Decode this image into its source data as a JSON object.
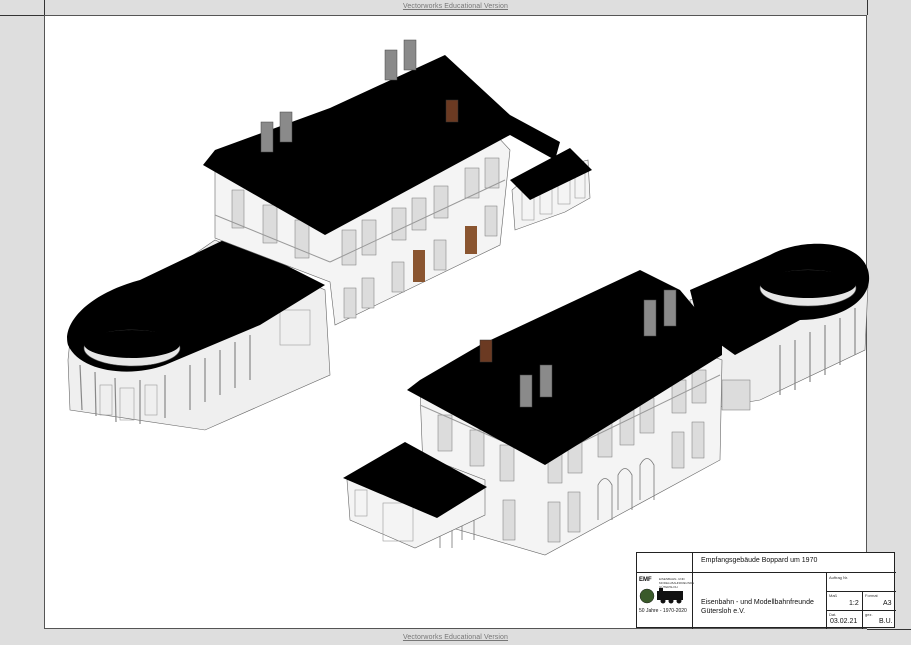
{
  "watermark": {
    "top": "Vectorworks Educational Version",
    "bottom": "Vectorworks Educational Version"
  },
  "title_block": {
    "title": "Empfangsgebäude Boppard um 1970",
    "logo": {
      "mark": "EMF",
      "line1": "EISENBAHN- UND",
      "line2": "MODELLBAHNFREUNDE",
      "line3": "GÜTERSLOH",
      "anniversary": "50 Jahre",
      "years": "1970-2020"
    },
    "club_name_line1": "Eisenbahn - und Modellbahnfreunde",
    "club_name_line2": "Gütersloh e.V.",
    "auftrag_label": "Auftrag Nr.",
    "scale_label": "Maß",
    "scale_value": "1:2",
    "format_label": "Format",
    "format_value": "A3",
    "date_label": "Dat.",
    "date_value": "03.02.21",
    "author_label": "gez.",
    "author_value": "B.U."
  },
  "colors": {
    "roof": "#000000",
    "wall": "#f2f2f2",
    "chimney": "#8a8a8a",
    "brick_chimney": "#6b3a22",
    "door": "#8a5530"
  }
}
